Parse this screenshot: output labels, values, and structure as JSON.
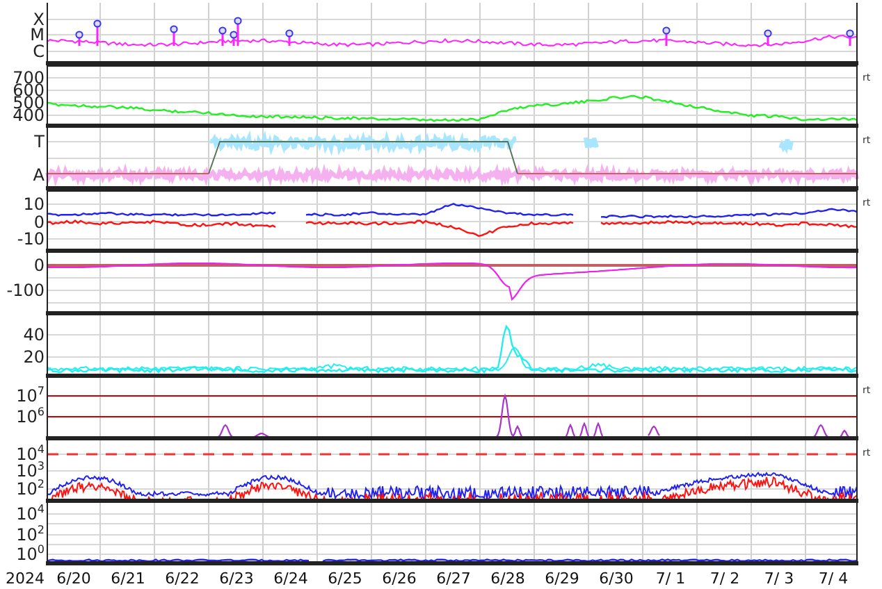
{
  "panels": [
    {
      "kind": "flare",
      "y_labels": [
        "X",
        "M",
        "C"
      ]
    },
    {
      "kind": "speed",
      "y_labels": [
        "700",
        "600",
        "500",
        "400"
      ],
      "marker": "rt",
      "chart_data": {
        "type": "line",
        "ylim": [
          300,
          800
        ],
        "yticks": [
          400,
          500,
          600,
          700
        ],
        "grid": true,
        "series": [
          {
            "color": "#22ee22",
            "values": [
              490,
              480,
              470,
              460,
              440,
              430,
              420,
              400,
              390,
              390,
              380,
              380,
              370,
              370,
              360,
              360,
              370,
              440,
              480,
              490,
              510,
              540,
              550,
              510,
              470,
              430,
              400,
              390,
              370,
              370,
              370
            ]
          }
        ]
      }
    },
    {
      "kind": "sector",
      "y_labels": [
        "T",
        "A"
      ],
      "marker": "rt"
    },
    {
      "kind": "imf",
      "y_labels": [
        "10",
        "0",
        "-10"
      ],
      "marker": "rt",
      "chart_data": {
        "type": "line",
        "ylim": [
          -18,
          18
        ],
        "yticks": [
          -10,
          0,
          10
        ],
        "grid": true,
        "series": [
          {
            "color": "#2222ee",
            "values": [
              4,
              4,
              5,
              4,
              4,
              4,
              4,
              4,
              5,
              null,
              4,
              4,
              5,
              4,
              4,
              10,
              8,
              5,
              4,
              4,
              null,
              3,
              3,
              3,
              3,
              3,
              4,
              4,
              5,
              7,
              6
            ]
          },
          {
            "color": "#ff1111",
            "values": [
              -1,
              0,
              -1,
              -1,
              0,
              -2,
              -2,
              -1,
              -3,
              null,
              -1,
              -1,
              -1,
              -1,
              0,
              -3,
              -8,
              -3,
              -1,
              -1,
              null,
              -1,
              -1,
              0,
              -1,
              -1,
              -1,
              -2,
              -1,
              -2,
              -3
            ]
          }
        ]
      }
    },
    {
      "kind": "dst",
      "y_labels": [
        "0",
        "-100"
      ]
    },
    {
      "kind": "density",
      "y_labels": [
        "40",
        "20"
      ]
    },
    {
      "kind": "electron",
      "y_labels": [
        "10$^{7}$",
        "10$^{6}$"
      ],
      "marker": "rt"
    },
    {
      "kind": "proton",
      "y_labels": [
        "10$^{4}$",
        "10$^{3}$",
        "10$^{2}$"
      ],
      "marker": "rt"
    },
    {
      "kind": "proton_low",
      "y_labels": [
        "10$^{4}$",
        "10$^{2}$",
        "10$^{0}$"
      ]
    }
  ],
  "time_axis": {
    "year": "2024",
    "days": [
      "6/20",
      "6/21",
      "6/22",
      "6/23",
      "6/24",
      "6/25",
      "6/26",
      "6/27",
      "6/28",
      "6/29",
      "6/30",
      "7/ 1",
      "7/ 2",
      "7/ 3",
      "7/ 4"
    ]
  }
}
